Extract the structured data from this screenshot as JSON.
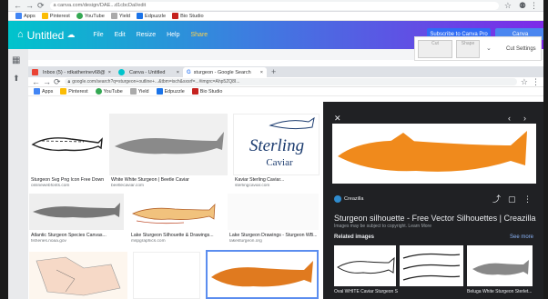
{
  "outer": {
    "url": "a canva.com/design/DAE...d1cbcDaI/edit",
    "bookmarks": [
      "Apps",
      "Pinterest",
      "YouTube",
      "Yield",
      "Edpuzzle",
      "Bio Studio"
    ]
  },
  "canva": {
    "title": "Untitled",
    "menu": [
      "File",
      "Edit",
      "Resize",
      "Help",
      "Share"
    ],
    "subscribe": "Subscribe to Canva Pro",
    "publish": "Canva",
    "cut_label": "Cut",
    "shape_label": "Shape",
    "cut_settings": "Cut Settings"
  },
  "inner": {
    "tabs": [
      "Inbox (5) - rdkatherinev68@...",
      "Canva - Untitled",
      "sturgeon - Google Search"
    ],
    "url": "google.com/search?q=sturgeon+outline+...&tbm=isch&sxsrf=...#imgrc=Ahp5ZQ8I...",
    "bookmarks": [
      "Apps",
      "Pinterest",
      "YouTube",
      "Yield",
      "Edpuzzle",
      "Bio Studio"
    ]
  },
  "results": [
    {
      "cap": "Sturgeon Svg Png Icon Free Down...",
      "src": "onlinewebfonts.com"
    },
    {
      "cap": "White White Sturgeon | Beetle Caviar",
      "src": "beetlecaviar.com"
    },
    {
      "cap": "Kaviar Sterling Caviar...",
      "src": "sterlingcaviar.com"
    },
    {
      "cap": "Atlantic Sturgeon Species Canvas...",
      "src": "fisheries.noaa.gov"
    },
    {
      "cap": "Lake Sturgeon Silhouette & Drawings...",
      "src": "mspgraphics.com"
    },
    {
      "cap": "Lake Sturgeon Drawings - Sturgeon WB...",
      "src": "lakesturgeon.org"
    }
  ],
  "logo": {
    "line1": "Sterling",
    "line2": "Caviar"
  },
  "panel": {
    "source": "Creazilla",
    "title": "Sturgeon silhouette - Free Vector Silhouettes | Creazilla",
    "subtitle": "Images may be subject to copyright. Learn More",
    "related": "Related images",
    "see_more": "See more",
    "thumbs": [
      "Oval WHITE Caviar Sturgeon Silh...",
      "",
      "Beluga White Sturgeon Sterlet..."
    ]
  },
  "colors": {
    "orange": "#f08a1c",
    "blue": "#2f6cf5",
    "dark": "#202124"
  }
}
